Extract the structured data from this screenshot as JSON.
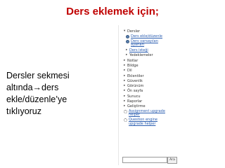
{
  "slide": {
    "title": "Ders eklemek için;",
    "body_lines": [
      "Dersler sekmesi",
      "altında",
      "ders",
      "ekle/düzenle’ye",
      "tıklıyoruz"
    ],
    "arrow": "→"
  },
  "tree": {
    "dersler": "Dersler",
    "ders_ekle": "Ders ekle/düzenle",
    "ders_varsayilan_1": "Ders varsayılan",
    "ders_varsayilan_2": "ayarları",
    "ders_istegi": "Ders isteği",
    "yedeklemeler": "Yedeklemeler",
    "items": [
      "Notlar",
      "Bildge",
      "Dil",
      "Eklentiler",
      "Güvenlik",
      "Görünüm",
      "Ön sayfa",
      "Sunucu",
      "Raporlar",
      "Geliştirme"
    ],
    "assignment_1": "Assignment upgrade",
    "assignment_2": "helper",
    "question_1": "Question engine",
    "question_2": "upgrade helper"
  },
  "search": {
    "button": "Ara"
  }
}
